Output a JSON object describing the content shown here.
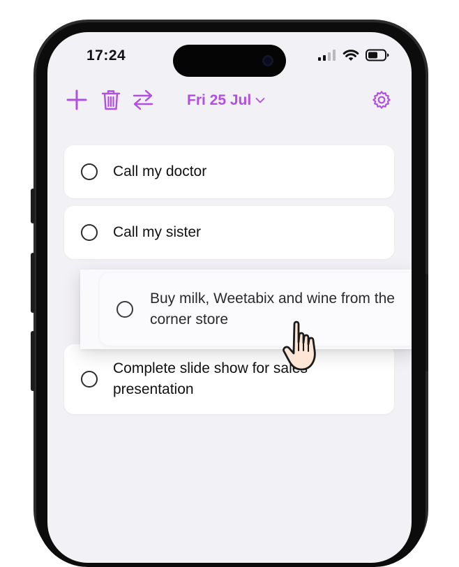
{
  "status_bar": {
    "time": "17:24"
  },
  "toolbar": {
    "date_label": "Fri 25 Jul",
    "accent_color": "#b24fe0",
    "icons": [
      "plus-icon",
      "trash-icon",
      "swap-arrows-icon",
      "chevron-down-icon",
      "gear-icon"
    ]
  },
  "tasks": [
    {
      "title": "Call my doctor",
      "done": false
    },
    {
      "title": "Call my sister",
      "done": false
    },
    {
      "title": "Buy milk, Weetabix and wine from the corner store",
      "done": false,
      "dragging": true
    },
    {
      "title": "Complete slide show for sales presentation",
      "done": false
    }
  ]
}
